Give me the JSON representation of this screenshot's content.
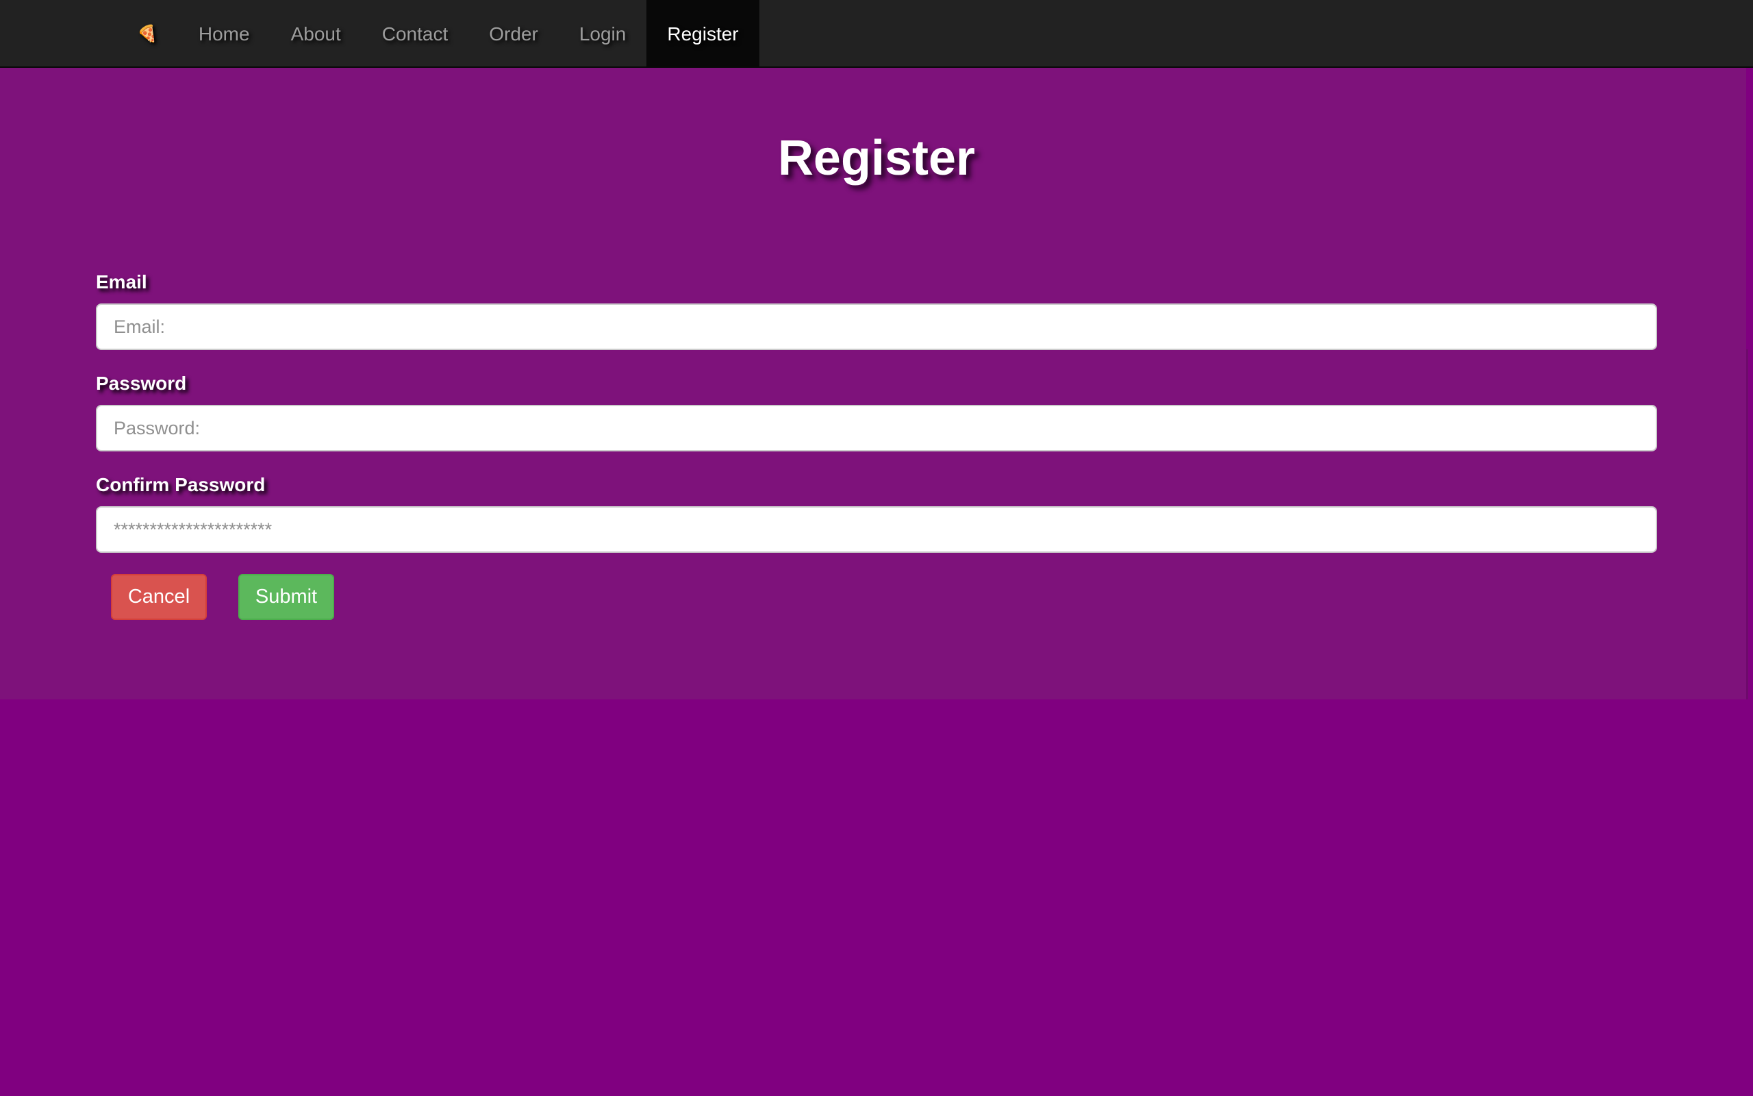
{
  "nav": {
    "brand_icon": "🍕",
    "brand_icon_name": "pizza-icon",
    "items": [
      {
        "label": "Home"
      },
      {
        "label": "About"
      },
      {
        "label": "Contact"
      },
      {
        "label": "Order"
      },
      {
        "label": "Login"
      },
      {
        "label": "Register",
        "active": true
      }
    ]
  },
  "page": {
    "title": "Register"
  },
  "form": {
    "email": {
      "label": "Email",
      "placeholder": "Email:",
      "value": ""
    },
    "password": {
      "label": "Password",
      "placeholder": "Password:",
      "value": ""
    },
    "confirm_password": {
      "label": "Confirm Password",
      "placeholder": "**********************",
      "value": ""
    },
    "cancel_label": "Cancel",
    "submit_label": "Submit"
  },
  "colors": {
    "nav_bg": "#222222",
    "nav_active_bg": "#080808",
    "page_bg": "#800080",
    "content_bg": "#7e127b",
    "cancel": "#d9534f",
    "submit": "#5cb85c"
  }
}
